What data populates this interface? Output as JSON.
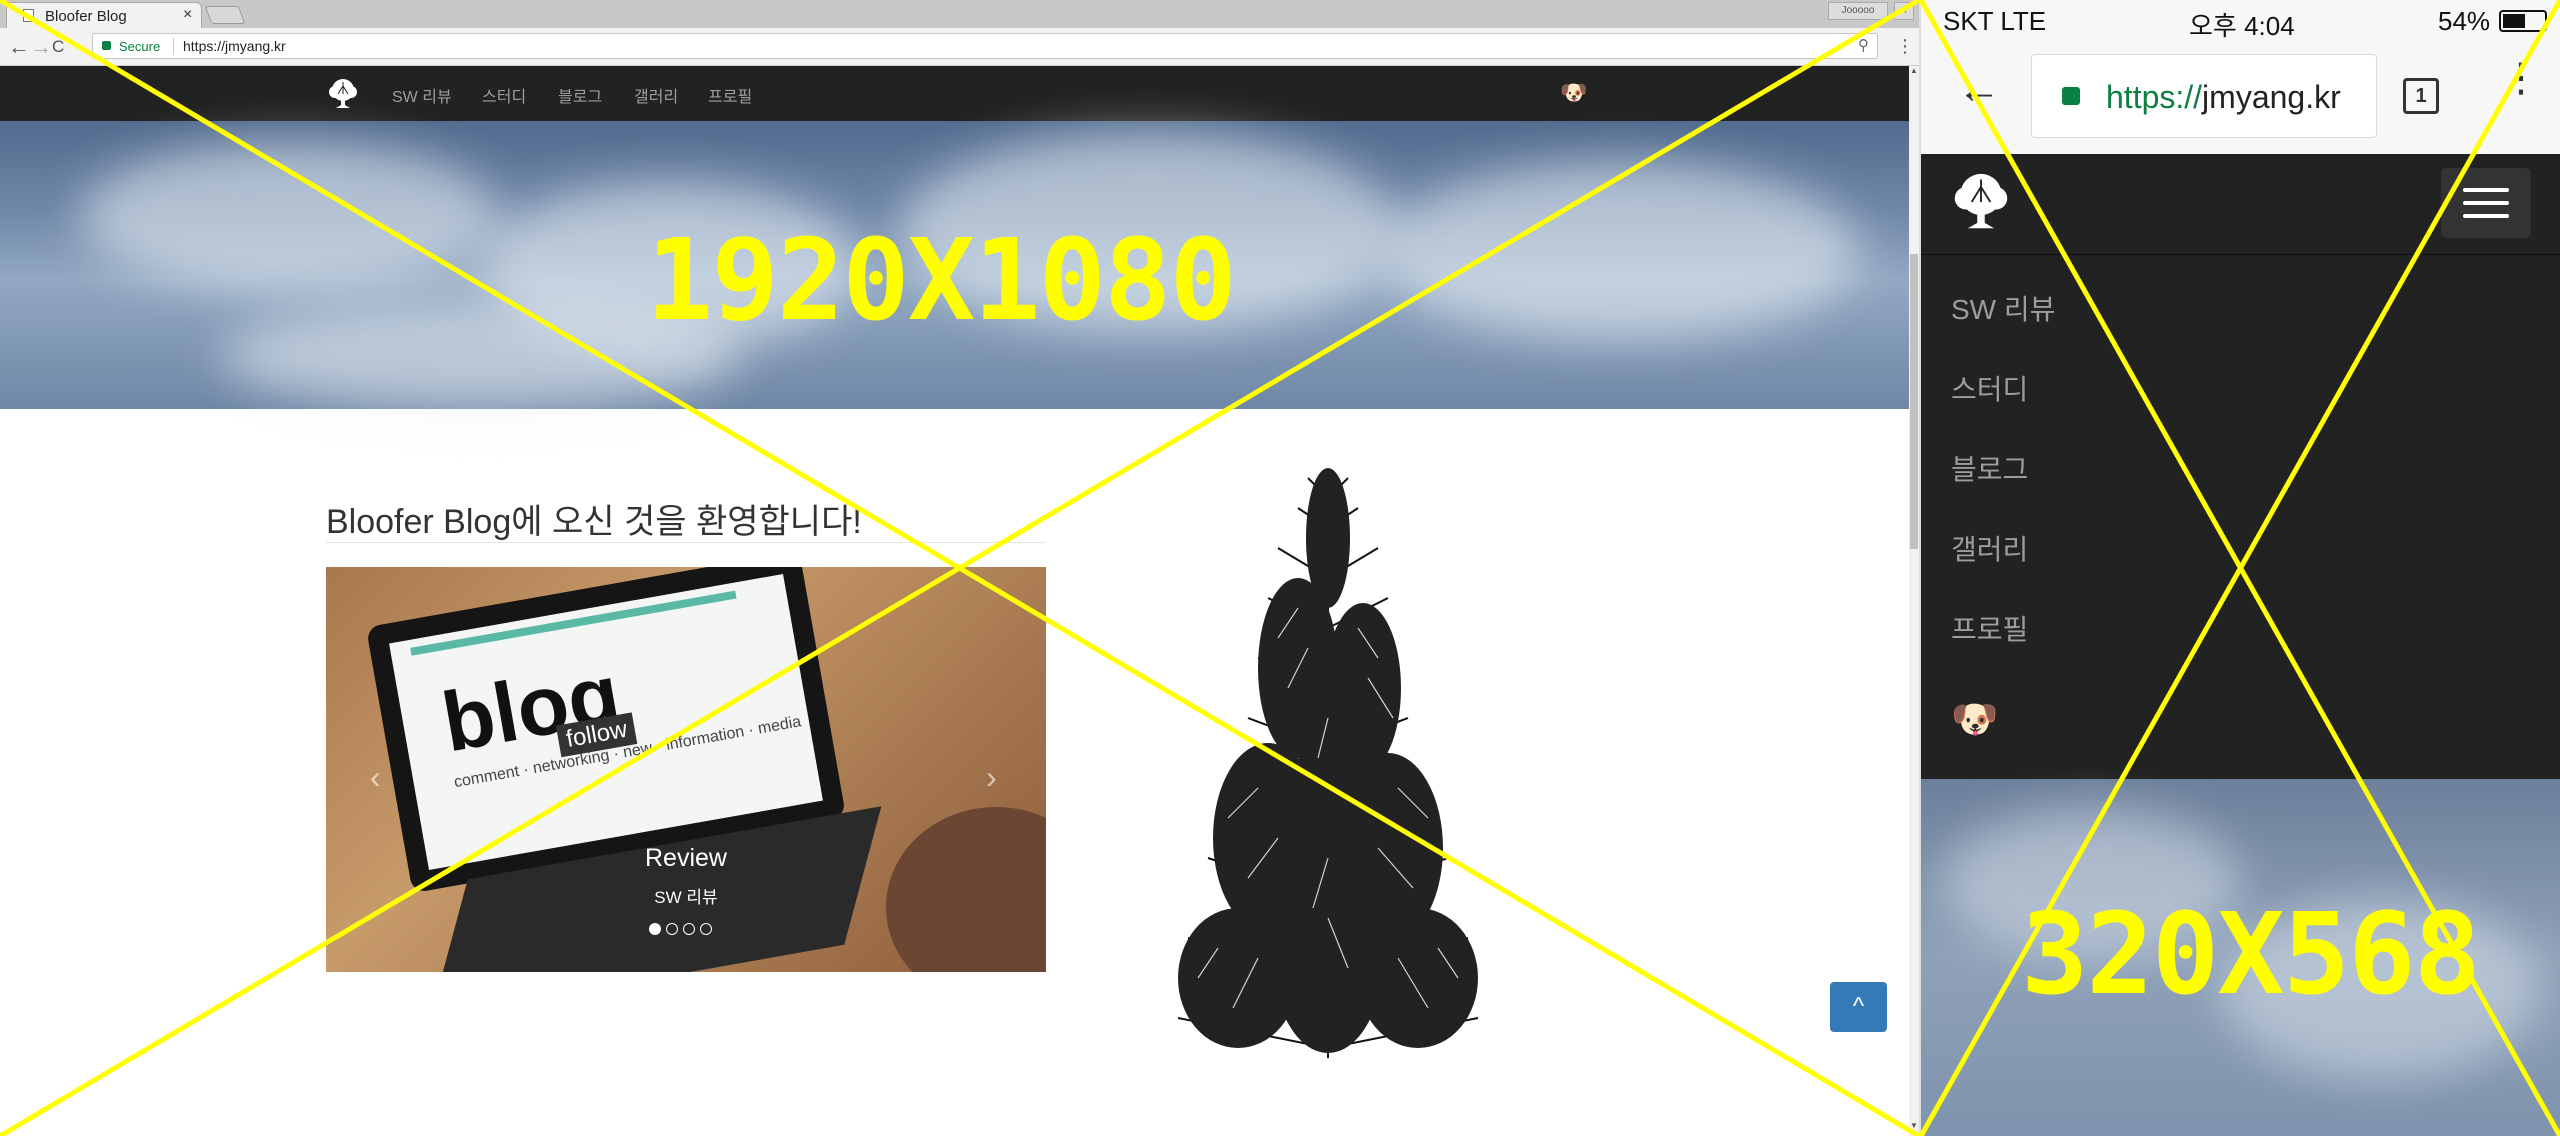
{
  "desktop": {
    "tab_title": "Bloofer Blog",
    "tab_close": "×",
    "window_user": "Jooooo",
    "window_close": "×",
    "nav_back": "←",
    "nav_forward": "→",
    "nav_reload": "C",
    "secure_label": "Secure",
    "url": "https://jmyang.kr",
    "zoom_icon": "⚲",
    "menu": "⋮",
    "nav_items": [
      "SW 리뷰",
      "스터디",
      "블로그",
      "갤러리",
      "프로필"
    ],
    "corgi": "🐶",
    "size_label": "1920X1080",
    "welcome": "Bloofer Blog에 오신 것을 환영합니다!",
    "carousel": {
      "title": "Review",
      "subtitle": "SW 리뷰",
      "screen_word": "blog",
      "screen_follow": "follow",
      "screen_words": "comment · networking · new · information · media",
      "prev": "‹",
      "next": "›",
      "active_slide": 1,
      "slide_count": 4
    },
    "to_top_icon": "^"
  },
  "mobile": {
    "carrier": "SKT  LTE",
    "time": "오후 4:04",
    "battery_pct": "54%",
    "battery_level": 0.54,
    "back": "←",
    "url_scheme": "https://",
    "url_host": "jmyang.kr",
    "tab_count": "1",
    "menu": "⋮",
    "nav_items": [
      "SW 리뷰",
      "스터디",
      "블로그",
      "갤러리",
      "프로필"
    ],
    "corgi": "🐶",
    "size_label": "320X568"
  },
  "colors": {
    "overlay_yellow": "#ffff00",
    "navbar": "#222222",
    "nav_text": "#9d9d9d",
    "secure_green": "#0b8043",
    "button_blue": "#337ab7"
  }
}
